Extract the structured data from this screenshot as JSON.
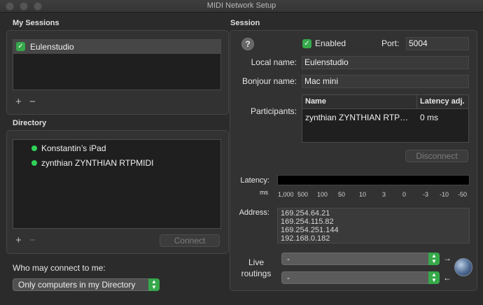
{
  "window": {
    "title": "MIDI Network Setup"
  },
  "my_sessions": {
    "label": "My Sessions",
    "items": [
      {
        "name": "Eulenstudio",
        "checked": true
      }
    ],
    "add": "+",
    "remove": "−"
  },
  "directory": {
    "label": "Directory",
    "items": [
      {
        "name": "Konstantin’s iPad",
        "status_color": "#30d158"
      },
      {
        "name": "zynthian ZYNTHIAN RTPMIDI",
        "status_color": "#30d158"
      }
    ],
    "add": "+",
    "remove": "−",
    "connect_label": "Connect"
  },
  "who_may_connect": {
    "label": "Who may connect to me:",
    "selected": "Only computers in my Directory"
  },
  "session": {
    "label": "Session",
    "help": "?",
    "enabled_label": "Enabled",
    "enabled": true,
    "port_label": "Port:",
    "port": "5004",
    "local_name_label": "Local name:",
    "local_name": "Eulenstudio",
    "bonjour_name_label": "Bonjour name:",
    "bonjour_name": "Mac mini",
    "participants_label": "Participants:",
    "participants_columns": [
      "Name",
      "Latency adj."
    ],
    "participants": [
      {
        "name": "zynthian ZYNTHIAN RTP…",
        "latency": "0 ms"
      }
    ],
    "disconnect_label": "Disconnect",
    "latency_label": "Latency:",
    "latency_unit": "ms",
    "latency_ticks": [
      "1,000",
      "500",
      "100",
      "50",
      "10",
      "3",
      "0",
      "-3",
      "-10",
      "-50"
    ],
    "address_label": "Address:",
    "addresses": [
      "169.254.64.21",
      "169.254.115.82",
      "169.254.251.144",
      "192.168.0.182"
    ],
    "live_routings_label": "Live routings",
    "routing_in": "-",
    "routing_out": "-"
  },
  "colors": {
    "accent_green": "#36a84a",
    "status_green": "#30d158"
  }
}
